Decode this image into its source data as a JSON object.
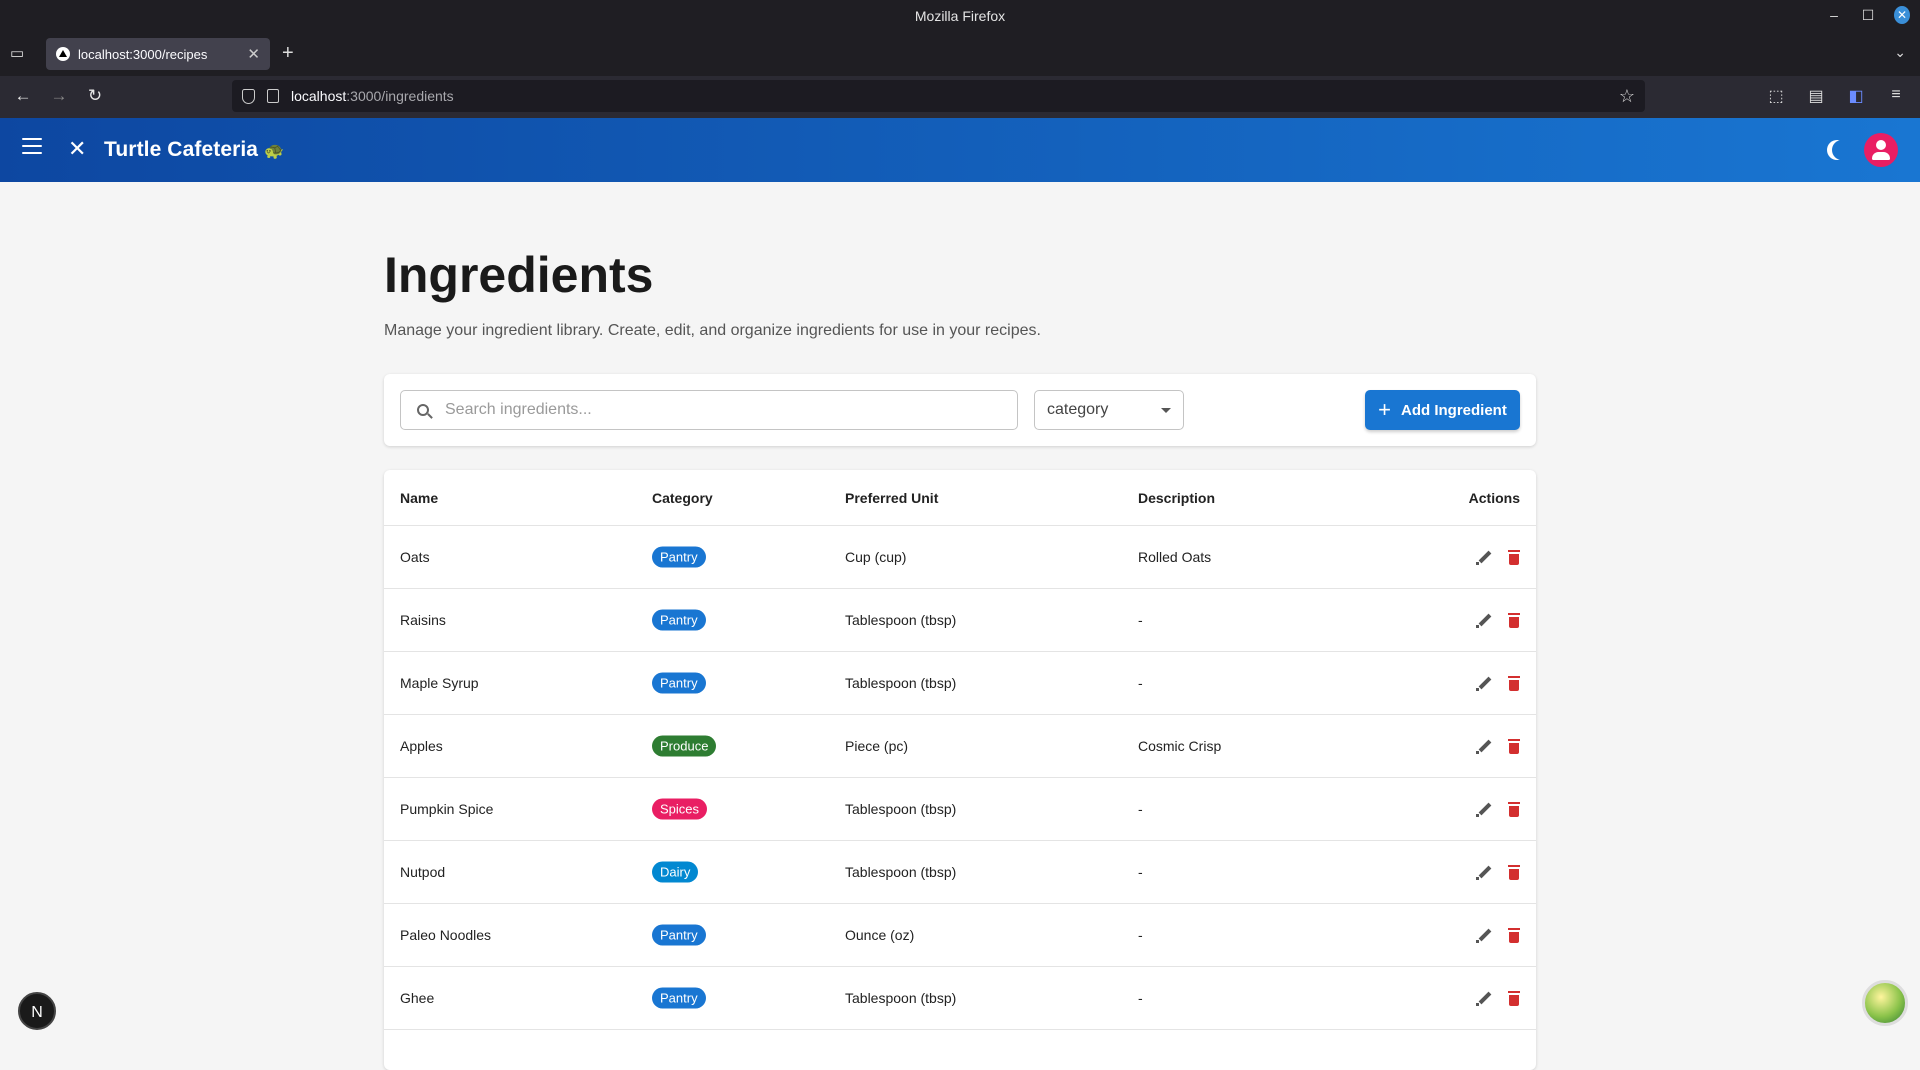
{
  "browser": {
    "window_title": "Mozilla Firefox",
    "tab_title": "localhost:3000/recipes",
    "url_host": "localhost",
    "url_path": ":3000/ingredients"
  },
  "app": {
    "brand": "Turtle Cafeteria",
    "brand_emoji": "🐢"
  },
  "page": {
    "title": "Ingredients",
    "subtitle": "Manage your ingredient library. Create, edit, and organize ingredients for use in your recipes."
  },
  "filters": {
    "search_placeholder": "Search ingredients...",
    "category_label": "category",
    "add_button": "Add Ingredient"
  },
  "table": {
    "headers": [
      "Name",
      "Category",
      "Preferred Unit",
      "Description",
      "Actions"
    ],
    "rows": [
      {
        "name": "Oats",
        "category": "Pantry",
        "unit": "Cup (cup)",
        "description": "Rolled Oats"
      },
      {
        "name": "Raisins",
        "category": "Pantry",
        "unit": "Tablespoon (tbsp)",
        "description": "-"
      },
      {
        "name": "Maple Syrup",
        "category": "Pantry",
        "unit": "Tablespoon (tbsp)",
        "description": "-"
      },
      {
        "name": "Apples",
        "category": "Produce",
        "unit": "Piece (pc)",
        "description": "Cosmic Crisp"
      },
      {
        "name": "Pumpkin Spice",
        "category": "Spices",
        "unit": "Tablespoon (tbsp)",
        "description": "-"
      },
      {
        "name": "Nutpod",
        "category": "Dairy",
        "unit": "Tablespoon (tbsp)",
        "description": "-"
      },
      {
        "name": "Paleo Noodles",
        "category": "Pantry",
        "unit": "Ounce (oz)",
        "description": "-"
      },
      {
        "name": "Ghee",
        "category": "Pantry",
        "unit": "Tablespoon (tbsp)",
        "description": "-"
      }
    ]
  },
  "category_colors": {
    "Pantry": "#1976d2",
    "Produce": "#2e7d32",
    "Spices": "#e91e63",
    "Dairy": "#0288d1"
  },
  "icons": {
    "menu": "menu-icon",
    "logo": "utensils-icon",
    "theme": "moon-icon",
    "account": "avatar-icon",
    "search": "search-icon",
    "add": "plus-icon",
    "edit": "pencil-icon",
    "delete": "trash-icon"
  },
  "dev_badge": "N"
}
